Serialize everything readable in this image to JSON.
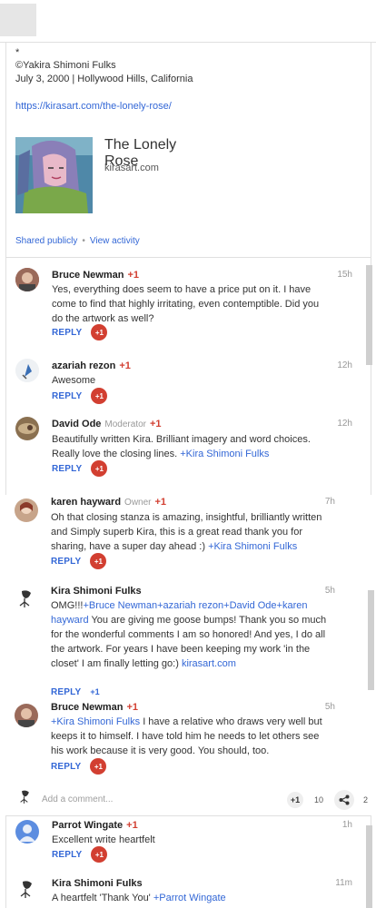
{
  "post": {
    "asterisk": "*",
    "copyright": "©Yakira Shimoni Fulks",
    "dateline": "July 3, 2000 | Hollywood Hills, California",
    "url": "https://kirasart.com/the-lonely-rose/",
    "card_title": "The Lonely Rose",
    "card_domain": "kirasart.com",
    "shared_label": "Shared publicly",
    "view_activity_label": "View activity"
  },
  "comments": [
    {
      "name": "Bruce Newman",
      "plus": "+1",
      "role": "",
      "time": "15h",
      "text": "Yes, everything does seem to have a price put on it. I have come to find that highly irritating, even contemptible. Did you do the artwork as well?",
      "reply": "REPLY",
      "plus_btn": "+1"
    },
    {
      "name": "azariah rezon",
      "plus": "+1",
      "role": "",
      "time": "12h",
      "text": "Awesome",
      "reply": "REPLY",
      "plus_btn": "+1"
    },
    {
      "name": "David Ode",
      "plus": "+1",
      "role": "Moderator",
      "time": "12h",
      "text": "Beautifully written Kira. Brilliant imagery and word choices. Really love the closing lines.",
      "mention": "+Kira Shimoni Fulks",
      "reply": "REPLY",
      "plus_btn": "+1"
    },
    {
      "name": "karen hayward",
      "plus": "+1",
      "role": "Owner",
      "time": "7h",
      "text": "Oh that closing stanza is amazing, insightful, brilliantly written and Simply superb Kira, this is a great read thank you for sharing, have a super day ahead :)",
      "mention": "+Kira Shimoni Fulks",
      "reply": "REPLY",
      "plus_btn": "+1"
    },
    {
      "name": "Kira Shimoni Fulks",
      "plus": "",
      "role": "",
      "time": "5h",
      "text_pre": "OMG!!!",
      "mentions": "+Bruce Newman+azariah rezon+David Ode+karen hayward",
      "text_post": "You are giving me goose bumps! Thank you so much for the wonderful comments I am so honored! And yes, I do all the artwork. For years I have been keeping my work 'in the closet' I am finally letting go:)",
      "link": "kirasart.com",
      "reply": "REPLY",
      "plus_btn": "+1"
    },
    {
      "name": "Bruce Newman",
      "plus": "+1",
      "role": "",
      "time": "5h",
      "mention": "+Kira Shimoni Fulks",
      "text": "I have a relative who draws very well but keeps it to himself. I have told him he needs to let others see his work because it is very good. You should, too.",
      "reply": "REPLY",
      "plus_btn": "+1"
    }
  ],
  "add_comment": {
    "placeholder": "Add a comment...",
    "plus_label": "+1",
    "plus_count": "10",
    "share_count": "2"
  },
  "lower_comments": [
    {
      "name": "Parrot Wingate",
      "plus": "+1",
      "time": "1h",
      "text": "Excellent write heartfelt",
      "reply": "REPLY",
      "plus_btn": "+1"
    },
    {
      "name": "Kira Shimoni Fulks",
      "time": "11m",
      "text": "A heartfelt 'Thank You'",
      "mention": "+Parrot Wingate"
    }
  ],
  "colors": {
    "accent_blue": "#3367d6",
    "plus_red": "#d23f31"
  }
}
